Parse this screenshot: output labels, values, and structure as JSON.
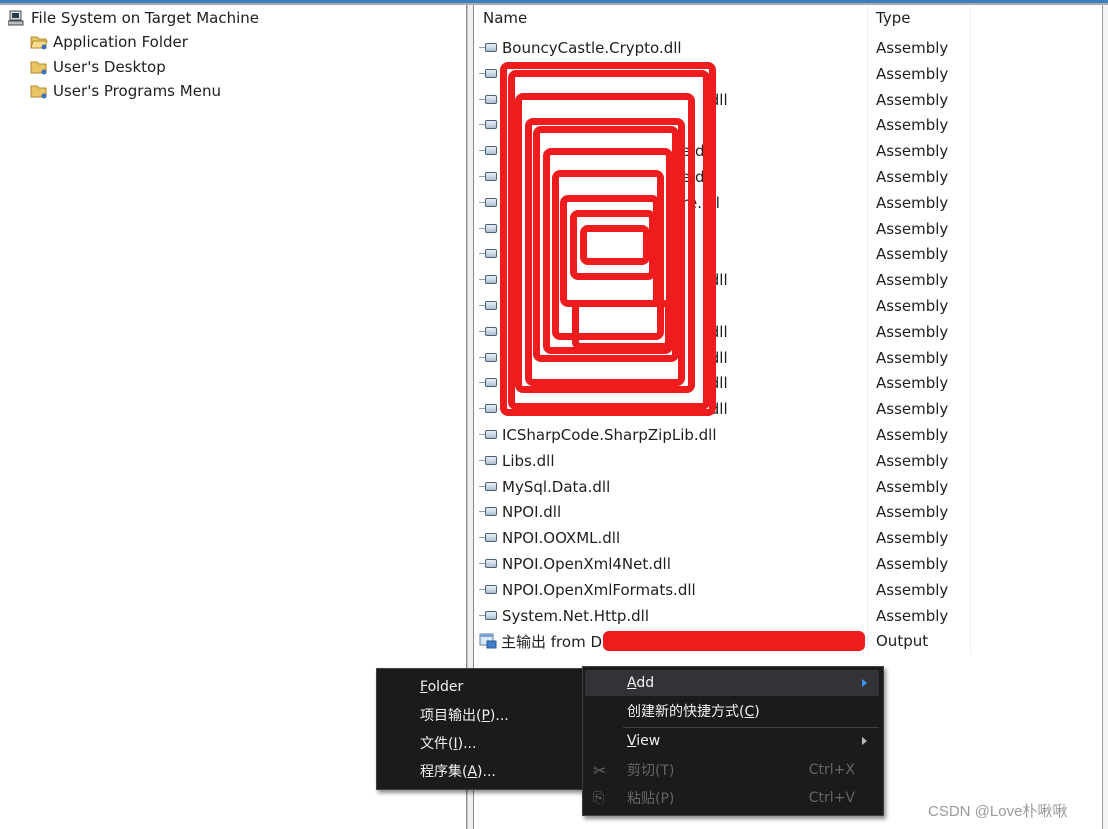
{
  "tree": {
    "root": {
      "label": "File System on Target Machine",
      "icon": "computer-icon"
    },
    "items": [
      {
        "label": "Application Folder",
        "icon": "special-folder-icon"
      },
      {
        "label": "User's Desktop",
        "icon": "special-folder-icon"
      },
      {
        "label": "User's Programs Menu",
        "icon": "special-folder-icon"
      }
    ]
  },
  "list": {
    "columns": [
      "Name",
      "Type"
    ],
    "rows": [
      {
        "name": "BouncyCastle.Crypto.dll",
        "type": "Assembly",
        "redacted": false
      },
      {
        "name": "",
        "type": "Assembly",
        "redacted": true
      },
      {
        "name": ".dll",
        "type": "Assembly",
        "redacted": true
      },
      {
        "name": "",
        "type": "Assembly",
        "redacted": true
      },
      {
        "name": "e.dll",
        "type": "Assembly",
        "redacted": true
      },
      {
        "name": "e.dll",
        "type": "Assembly",
        "redacted": true
      },
      {
        "name": "ore.dll",
        "type": "Assembly",
        "redacted": true
      },
      {
        "name": "",
        "type": "Assembly",
        "redacted": true
      },
      {
        "name": "",
        "type": "Assembly",
        "redacted": true
      },
      {
        "name": ".dll",
        "type": "Assembly",
        "redacted": true
      },
      {
        "name": "",
        "type": "Assembly",
        "redacted": true
      },
      {
        "name": ".dll",
        "type": "Assembly",
        "redacted": true
      },
      {
        "name": ".dll",
        "type": "Assembly",
        "redacted": true
      },
      {
        "name": ".dll",
        "type": "Assembly",
        "redacted": true
      },
      {
        "name": ".dll",
        "type": "Assembly",
        "redacted": true
      },
      {
        "name": "ICSharpCode.SharpZipLib.dll",
        "type": "Assembly",
        "redacted": false
      },
      {
        "name": "Libs.dll",
        "type": "Assembly",
        "redacted": false
      },
      {
        "name": "MySql.Data.dll",
        "type": "Assembly",
        "redacted": false
      },
      {
        "name": "NPOI.dll",
        "type": "Assembly",
        "redacted": false
      },
      {
        "name": "NPOI.OOXML.dll",
        "type": "Assembly",
        "redacted": false
      },
      {
        "name": "NPOI.OpenXml4Net.dll",
        "type": "Assembly",
        "redacted": false
      },
      {
        "name": "NPOI.OpenXmlFormats.dll",
        "type": "Assembly",
        "redacted": false
      },
      {
        "name": "System.Net.Http.dll",
        "type": "Assembly",
        "redacted": false
      },
      {
        "name": "主输出 from D",
        "type": "Output",
        "redacted": false,
        "icon": "project-output-icon"
      }
    ]
  },
  "context_menu": {
    "items": [
      {
        "label": "Add",
        "accel": "A",
        "submenu": true,
        "highlighted": true
      },
      {
        "label": "创建新的快捷方式(C)",
        "accel": "C"
      },
      {
        "label": "View",
        "accel": "V",
        "submenu": true
      },
      {
        "label": "剪切(T)",
        "shortcut": "Ctrl+X",
        "disabled": true,
        "icon": "scissors-icon"
      },
      {
        "label": "粘贴(P)",
        "shortcut": "Ctrl+V",
        "disabled": true,
        "icon": "paste-icon"
      }
    ]
  },
  "add_submenu": {
    "items": [
      {
        "label": "Folder",
        "accel": "F"
      },
      {
        "label": "项目输出(P)...",
        "accel": "P"
      },
      {
        "label": "文件(I)...",
        "accel": "I"
      },
      {
        "label": "程序集(A)...",
        "accel": "A"
      }
    ]
  },
  "watermark": "CSDN @Love朴啾啾",
  "colors": {
    "redaction": "#ee1c1c",
    "menu_bg": "#1b1b1c",
    "menu_highlight": "#333337",
    "submenu_arrow_active": "#3794ff"
  }
}
